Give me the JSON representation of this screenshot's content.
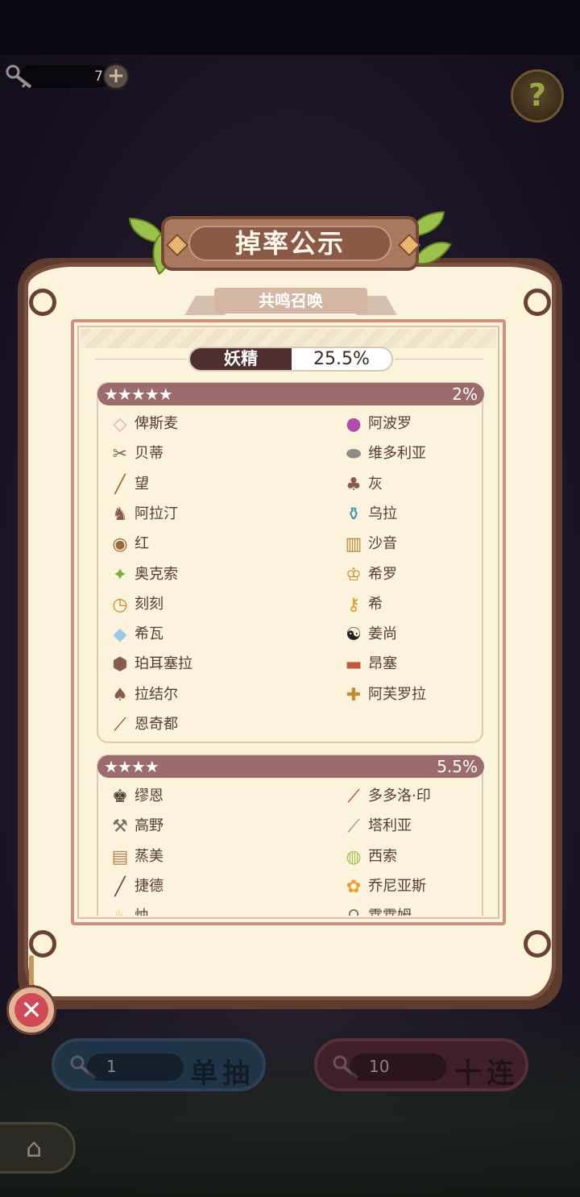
{
  "currency": {
    "count": "7",
    "plus_label": "+"
  },
  "help_label": "?",
  "title": "掉率公示",
  "subtitle": "共鸣召唤",
  "tab": {
    "name": "妖精",
    "rate": "25.5%"
  },
  "tiers": [
    {
      "stars": "★★★★★",
      "rate": "2%",
      "items": [
        {
          "name": "俾斯麦",
          "icon": "pink-crystal-icon",
          "glyph": "◇",
          "color": "#f29ac0"
        },
        {
          "name": "阿波罗",
          "icon": "purple-orb-icon",
          "glyph": "●",
          "color": "#b24bb0"
        },
        {
          "name": "贝蒂",
          "icon": "scissors-icon",
          "glyph": "✂",
          "color": "#8a5a4a"
        },
        {
          "name": "维多利亚",
          "icon": "plate-icon",
          "glyph": "⬬",
          "color": "#8e8e86"
        },
        {
          "name": "望",
          "icon": "telescope-icon",
          "glyph": "╱",
          "color": "#9a6a28"
        },
        {
          "name": "灰",
          "icon": "ash-icon",
          "glyph": "♣",
          "color": "#8a5a4a"
        },
        {
          "name": "阿拉汀",
          "icon": "dinosaur-icon",
          "glyph": "♞",
          "color": "#8a5a4a"
        },
        {
          "name": "乌拉",
          "icon": "potion-icon",
          "glyph": "⚱",
          "color": "#3e94a6"
        },
        {
          "name": "红",
          "icon": "basket-icon",
          "glyph": "◉",
          "color": "#9b6a3a"
        },
        {
          "name": "沙音",
          "icon": "cage-icon",
          "glyph": "▥",
          "color": "#b88a3a"
        },
        {
          "name": "奥克索",
          "icon": "pinwheel-icon",
          "glyph": "✦",
          "color": "#7eae3a"
        },
        {
          "name": "希罗",
          "icon": "crown-icon",
          "glyph": "♔",
          "color": "#c98a2a"
        },
        {
          "name": "刻刻",
          "icon": "pocket-watch-icon",
          "glyph": "◷",
          "color": "#c98a2a"
        },
        {
          "name": "希",
          "icon": "key-icon",
          "glyph": "⚷",
          "color": "#d89a2a"
        },
        {
          "name": "希瓦",
          "icon": "ice-icon",
          "glyph": "◆",
          "color": "#9ac8e8"
        },
        {
          "name": "姜尚",
          "icon": "yin-yang-icon",
          "glyph": "☯",
          "color": "#222222"
        },
        {
          "name": "珀耳塞拉",
          "icon": "stone-icon",
          "glyph": "⬢",
          "color": "#8a5a4a"
        },
        {
          "name": "昂塞",
          "icon": "book-icon",
          "glyph": "▬",
          "color": "#c2593a"
        },
        {
          "name": "拉结尔",
          "icon": "scroll-icon",
          "glyph": "♠",
          "color": "#8a5a4a"
        },
        {
          "name": "阿芙罗拉",
          "icon": "scepter-icon",
          "glyph": "✚",
          "color": "#c98a2a"
        },
        {
          "name": "恩奇都",
          "icon": "staff-icon",
          "glyph": "⟋",
          "color": "#8a3a2a"
        }
      ]
    },
    {
      "stars": "★★★★",
      "rate": "5.5%",
      "items": [
        {
          "name": "缪恩",
          "icon": "chess-king-icon",
          "glyph": "♚",
          "color": "#4a3a30"
        },
        {
          "name": "多多洛·印",
          "icon": "seal-brush-icon",
          "glyph": "⟋",
          "color": "#b02a2a"
        },
        {
          "name": "高野",
          "icon": "hammer-icon",
          "glyph": "⚒",
          "color": "#7a6a5a"
        },
        {
          "name": "塔利亚",
          "icon": "sword-icon",
          "glyph": "⟋",
          "color": "#8a8a8a"
        },
        {
          "name": "蒸美",
          "icon": "steamer-icon",
          "glyph": "▤",
          "color": "#b8824a"
        },
        {
          "name": "西索",
          "icon": "tape-icon",
          "glyph": "◍",
          "color": "#a8c05a"
        },
        {
          "name": "捷德",
          "icon": "needle-icon",
          "glyph": "╱",
          "color": "#6a4a3a"
        },
        {
          "name": "乔尼亚斯",
          "icon": "fruits-icon",
          "glyph": "✿",
          "color": "#e8a02a"
        },
        {
          "name": "烛",
          "icon": "candle-icon",
          "glyph": "♨",
          "color": "#e8c05a"
        },
        {
          "name": "霖霖姆",
          "icon": "tool-icon",
          "glyph": "⚲",
          "color": "#7a7a7a"
        }
      ]
    }
  ],
  "buttons": {
    "close_label": "✕",
    "single": {
      "count": "1",
      "label": "单抽"
    },
    "ten": {
      "count": "10",
      "label": "十连"
    },
    "home_label": "⌂"
  }
}
